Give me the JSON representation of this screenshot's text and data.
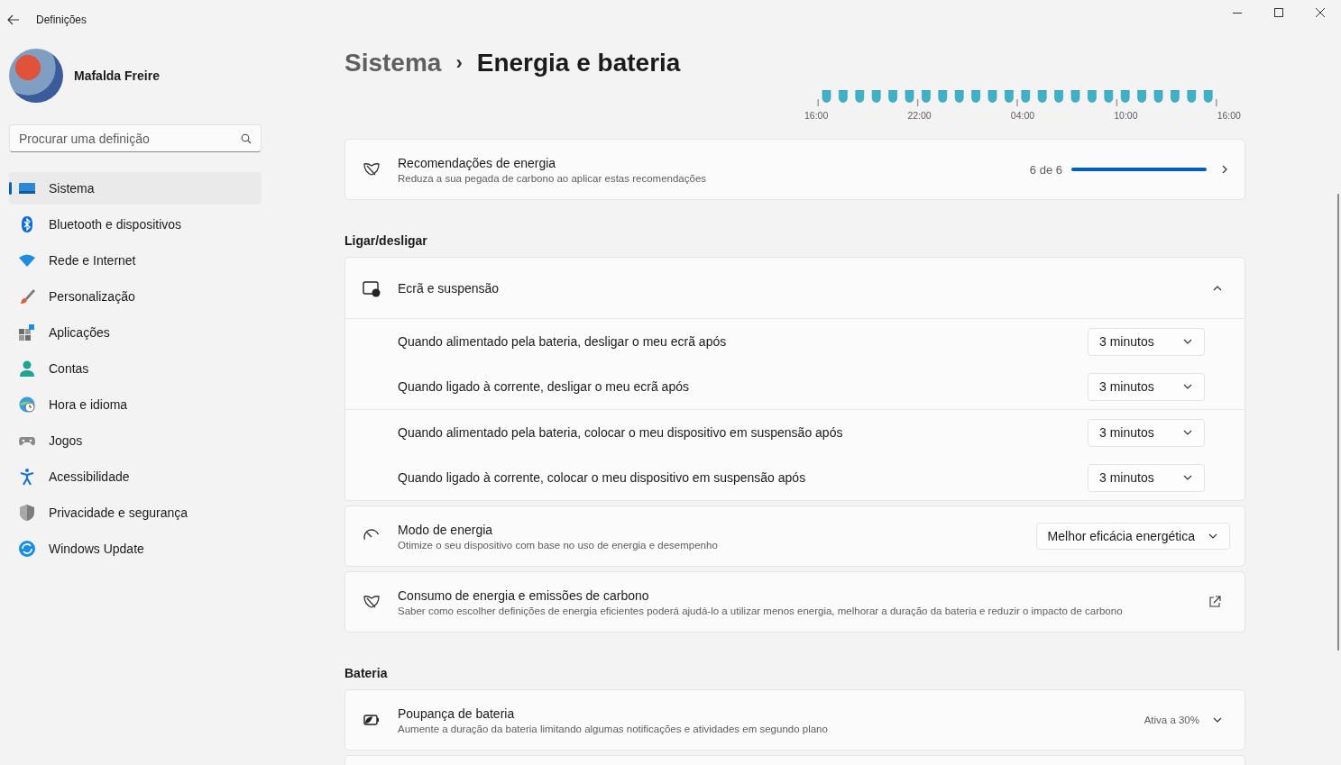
{
  "window": {
    "title": "Definições"
  },
  "user": {
    "name": "Mafalda Freire"
  },
  "search": {
    "placeholder": "Procurar uma definição"
  },
  "sidebar": {
    "items": [
      {
        "label": "Sistema",
        "selected": true
      },
      {
        "label": "Bluetooth e dispositivos",
        "selected": false
      },
      {
        "label": "Rede e Internet",
        "selected": false
      },
      {
        "label": "Personalização",
        "selected": false
      },
      {
        "label": "Aplicações",
        "selected": false
      },
      {
        "label": "Contas",
        "selected": false
      },
      {
        "label": "Hora e idioma",
        "selected": false
      },
      {
        "label": "Jogos",
        "selected": false
      },
      {
        "label": "Acessibilidade",
        "selected": false
      },
      {
        "label": "Privacidade e segurança",
        "selected": false
      },
      {
        "label": "Windows Update",
        "selected": false
      }
    ]
  },
  "breadcrumb": {
    "parent": "Sistema",
    "separator": "›",
    "current": "Energia e bateria"
  },
  "battery_chart": {
    "time_labels": [
      "16:00",
      "22:00",
      "04:00",
      "10:00",
      "16:00"
    ]
  },
  "recommendations": {
    "title": "Recomendações de energia",
    "subtitle": "Reduza a sua pegada de carbono ao aplicar estas recomendações",
    "count": "6 de 6",
    "level": 1
  },
  "sections": [
    {
      "header": "Ligar/desligar",
      "screen_sleep": {
        "title": "Ecrã e suspensão",
        "expanded": true,
        "groups": [
          [
            {
              "label": "Quando alimentado pela bateria, desligar o meu ecrã após",
              "value": "3 minutos"
            },
            {
              "label": "Quando ligado à corrente, desligar o meu ecrã após",
              "value": "3 minutos"
            }
          ],
          [
            {
              "label": "Quando alimentado pela bateria, colocar o meu dispositivo em suspensão após",
              "value": "3 minutos"
            },
            {
              "label": "Quando ligado à corrente, colocar o meu dispositivo em suspensão após",
              "value": "3 minutos"
            }
          ]
        ]
      },
      "cards": [
        {
          "kind": "dropdown",
          "title": "Modo de energia",
          "subtitle": "Otimize o seu dispositivo com base no uso de energia e desempenho",
          "value": "Melhor eficácia energética"
        },
        {
          "kind": "link",
          "title": "Consumo de energia e emissões de carbono",
          "subtitle": "Saber como escolher definições de energia eficientes poderá ajudá-lo a utilizar menos energia, melhorar a duração da bateria e reduzir o impacto de carbono"
        }
      ]
    },
    {
      "header": "Bateria",
      "cards": [
        {
          "kind": "expander",
          "title": "Poupança de bateria",
          "subtitle": "Aumente a duração da bateria limitando algumas notificações e atividades em segundo plano",
          "status": "Ativa a 30%",
          "expanded": false
        }
      ]
    }
  ]
}
